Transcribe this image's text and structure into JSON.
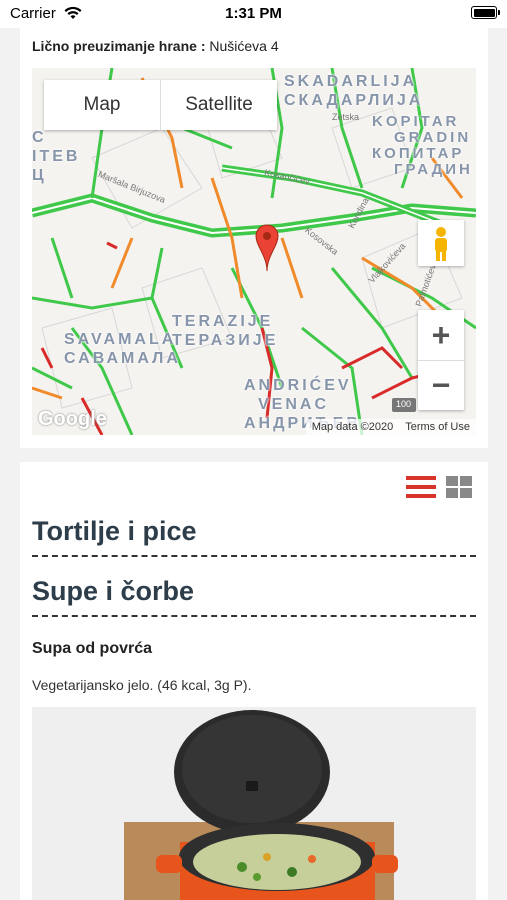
{
  "status_bar": {
    "carrier": "Carrier",
    "time": "1:31 PM"
  },
  "pickup": {
    "label": "Lično preuzimanje hrane :",
    "address": "Nušićeva 4"
  },
  "map": {
    "type_buttons": [
      "Map",
      "Satellite"
    ],
    "district_labels": [
      {
        "lines": [
          "SKADARLIJA",
          "СКАДАРЛИЈА"
        ]
      },
      {
        "lines": [
          "KOPITAR",
          "GRADIN",
          "КОПИТАР",
          "ГРАДИН"
        ]
      },
      {
        "lines": [
          "TERAZIJE",
          "ТЕРАЗИЈЕ"
        ]
      },
      {
        "lines": [
          "SAVAMALA",
          "САВАМАЛА"
        ]
      },
      {
        "lines": [
          "ANDRIĆEV",
          "VENAC",
          "АНДРИЋЕВ"
        ]
      },
      {
        "lines": [
          "C",
          "ITEB",
          "Ц"
        ]
      }
    ],
    "street_labels": [
      "Zetska",
      "Kosovska",
      "Kondina",
      "Vlajkovićeva",
      "Palmotićeva",
      "Maršala Birjuzova",
      "Kosančićev"
    ],
    "road_shield": "100",
    "zoom_in": "+",
    "zoom_out": "−",
    "google_logo": "Google",
    "footer": [
      "Map data ©2020",
      "Terms of Use"
    ]
  },
  "menu": {
    "categories": [
      "Tortilje i pice",
      "Supe i čorbe"
    ],
    "item": {
      "name": "Supa od povrća",
      "description": "Vegetarijansko jelo. (46 kcal, 3g P)."
    }
  },
  "colors": {
    "accent": "#d9342b",
    "heading": "#2e3d4a",
    "traffic_green": "#3fc84a",
    "traffic_orange": "#f08a2a",
    "traffic_red": "#d92a2a"
  }
}
